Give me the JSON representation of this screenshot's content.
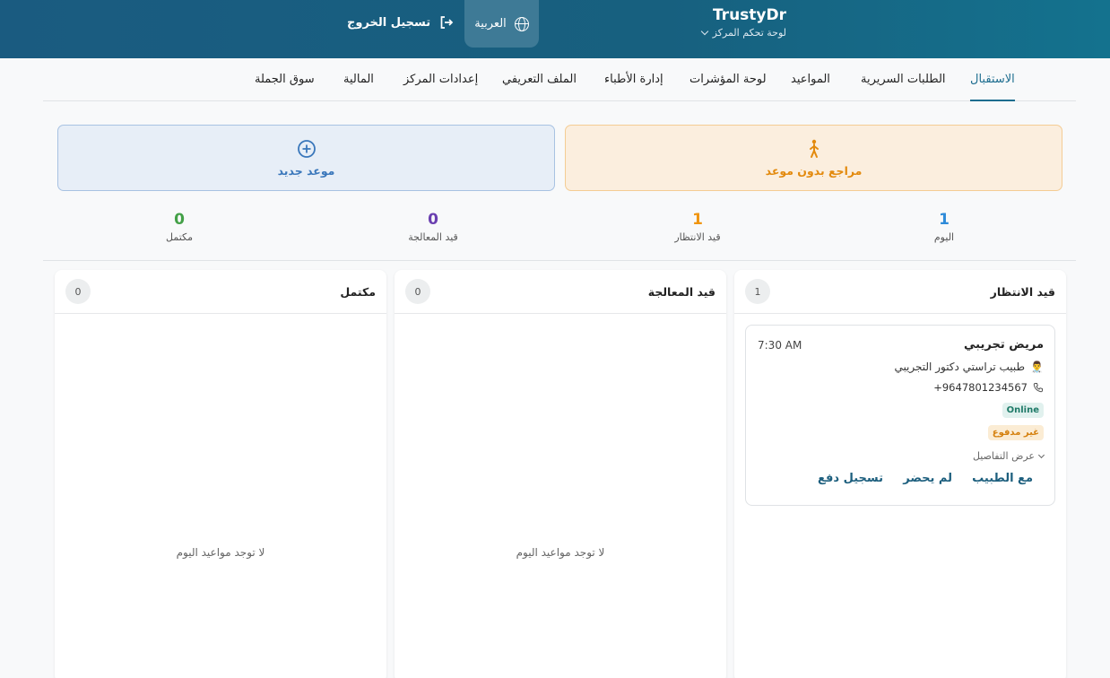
{
  "header": {
    "brand": "TrustyDr",
    "subtitle": "لوحة تحكم المركز",
    "language": "العربية",
    "logout": "تسجيل الخروج"
  },
  "tabs": [
    {
      "label": "الاستقبال",
      "active": true
    },
    {
      "label": "الطلبات السريرية"
    },
    {
      "label": "المواعيد"
    },
    {
      "label": "لوحة المؤشرات"
    },
    {
      "label": "إدارة الأطباء"
    },
    {
      "label": "الملف التعريفي"
    },
    {
      "label": "إعدادات المركز"
    },
    {
      "label": "المالية"
    },
    {
      "label": "سوق الجملة"
    }
  ],
  "actions": {
    "walkin": "مراجع بدون موعد",
    "new_appointment": "موعد جديد"
  },
  "stats": [
    {
      "value": "1",
      "label": "اليوم",
      "color": "#2e8bd9"
    },
    {
      "value": "1",
      "label": "قيد الانتظار",
      "color": "#f0950f"
    },
    {
      "value": "0",
      "label": "قيد المعالجة",
      "color": "#6a3fb0"
    },
    {
      "value": "0",
      "label": "مكتمل",
      "color": "#43a047"
    }
  ],
  "columns": {
    "waiting": {
      "title": "قيد الانتظار",
      "count": "1"
    },
    "processing": {
      "title": "قيد المعالجة",
      "count": "0",
      "empty": "لا توجد مواعيد اليوم"
    },
    "completed": {
      "title": "مكتمل",
      "count": "0",
      "empty": "لا توجد مواعيد اليوم"
    }
  },
  "appointment": {
    "patient": "مريض تجريبي",
    "time": "7:30 AM",
    "doctor": "طبيب تراستي دكتور التجريبي",
    "doctor_icon": "👨‍⚕️",
    "phone": "+9647801234567",
    "badge_online": "Online",
    "badge_unpaid": "غير مدفوع",
    "details": "عرض التفاصيل",
    "btn_with_doctor": "مع الطبيب",
    "btn_no_show": "لم يحضر",
    "btn_payment": "تسجيل دفع"
  }
}
